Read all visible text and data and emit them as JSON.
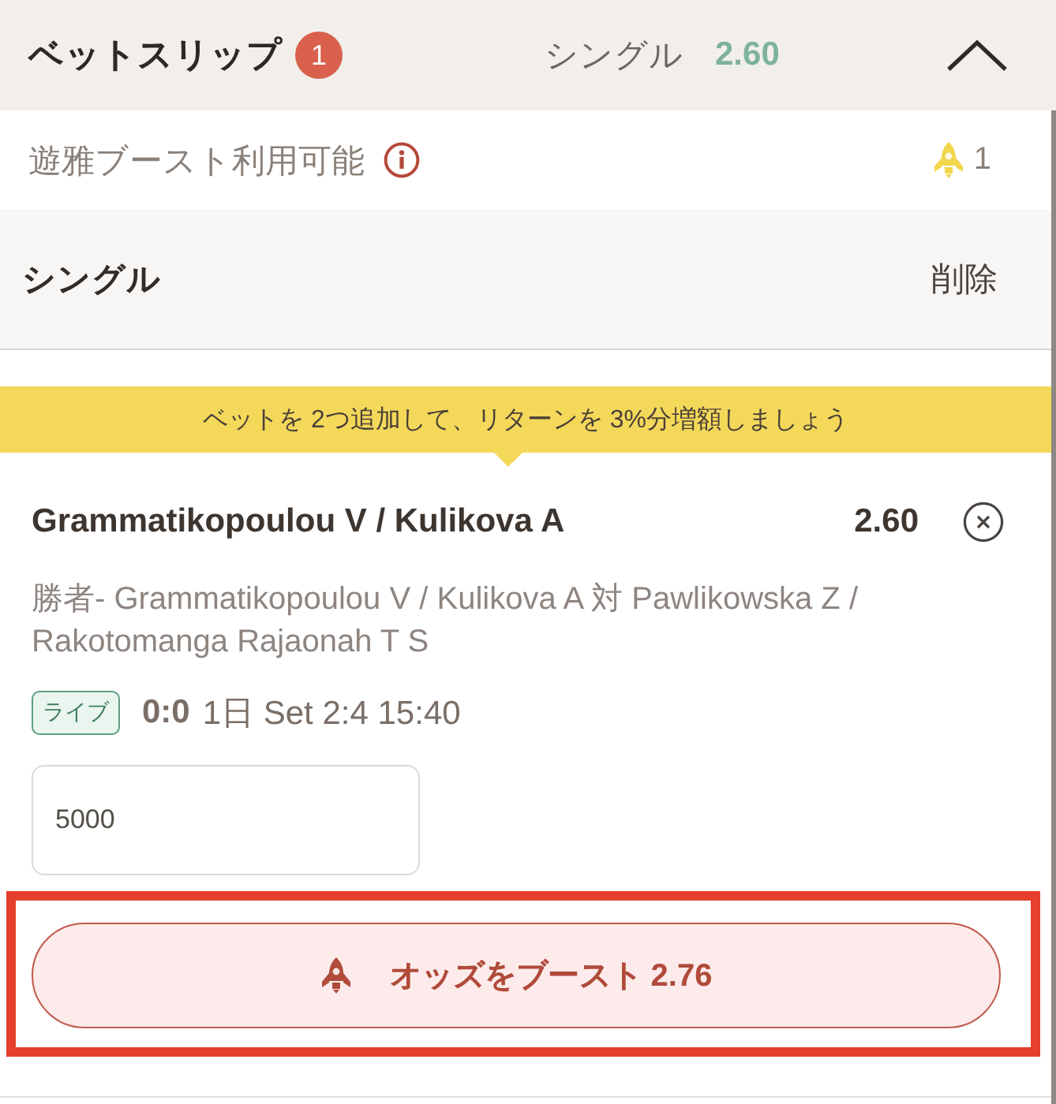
{
  "header": {
    "title": "ベットスリップ",
    "count": "1",
    "bet_type": "シングル",
    "odds": "2.60",
    "expanded": true
  },
  "boost_info": {
    "label": "遊雅ブースト利用可能",
    "available": "1"
  },
  "section": {
    "title": "シングル",
    "action": "削除"
  },
  "promo": {
    "text": "ベットを 2つ追加して、リターンを 3%分増額しましょう"
  },
  "bet": {
    "selection": "Grammatikopoulou V / Kulikova A",
    "odds": "2.60",
    "market": "勝者- Grammatikopoulou V / Kulikova A 対 Pawlikowska Z / Rakotomanga Rajaonah T S",
    "live": true,
    "live_label": "ライブ",
    "score": "0:0",
    "status": "1日 Set 2:4 15:40",
    "stake": "5000"
  },
  "boost_button": {
    "label": "オッズをブースト 2.76",
    "highlighted": true
  }
}
